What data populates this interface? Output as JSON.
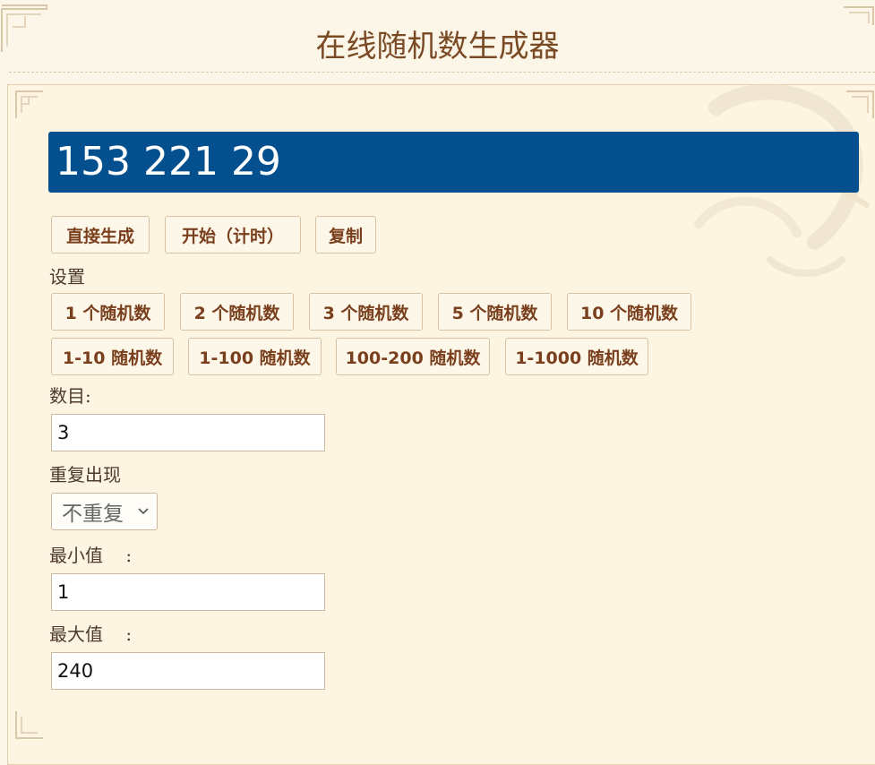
{
  "header": {
    "title": "在线随机数生成器"
  },
  "result": {
    "text": "153 221 29"
  },
  "actions": {
    "generate": "直接生成",
    "timed": "开始（计时）",
    "copy": "复制"
  },
  "settings_label": "设置",
  "presets_count": [
    "1 个随机数",
    "2 个随机数",
    "3 个随机数",
    "5 个随机数",
    "10 个随机数"
  ],
  "presets_range": [
    "1-10 随机数",
    "1-100 随机数",
    "100-200 随机数",
    "1-1000 随机数"
  ],
  "form": {
    "count_label": "数目:",
    "count_value": "3",
    "repeat_label": "重复出现",
    "repeat_value": "不重复",
    "min_label": "最小值    :",
    "min_value": "1",
    "max_label": "最大值    :",
    "max_value": "240"
  },
  "colors": {
    "result_bg": "#04508f",
    "button_text": "#7a3f1c",
    "page_bg": "#fcf6e8"
  }
}
